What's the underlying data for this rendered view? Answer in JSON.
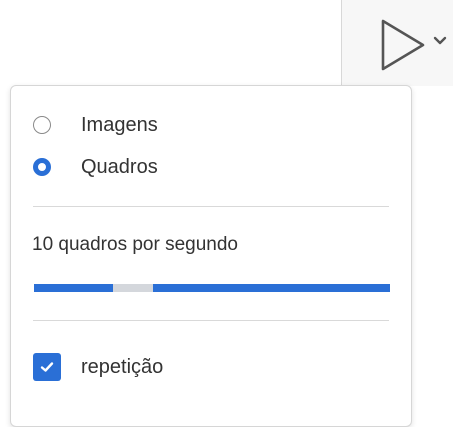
{
  "toolbar": {
    "play_icon": "play-icon",
    "dropdown_icon": "chevron-down-icon"
  },
  "panel": {
    "mode_options": [
      {
        "label": "Imagens",
        "checked": false
      },
      {
        "label": "Quadros",
        "checked": true
      }
    ],
    "fps_label": "10 quadros por segundo",
    "fps_slider_level": 0.25,
    "repeat_label": "repetição",
    "repeat_checked": true
  },
  "colors": {
    "accent": "#2a6fd6",
    "text": "#333333",
    "slider_thumb": "#d4d7dc"
  }
}
